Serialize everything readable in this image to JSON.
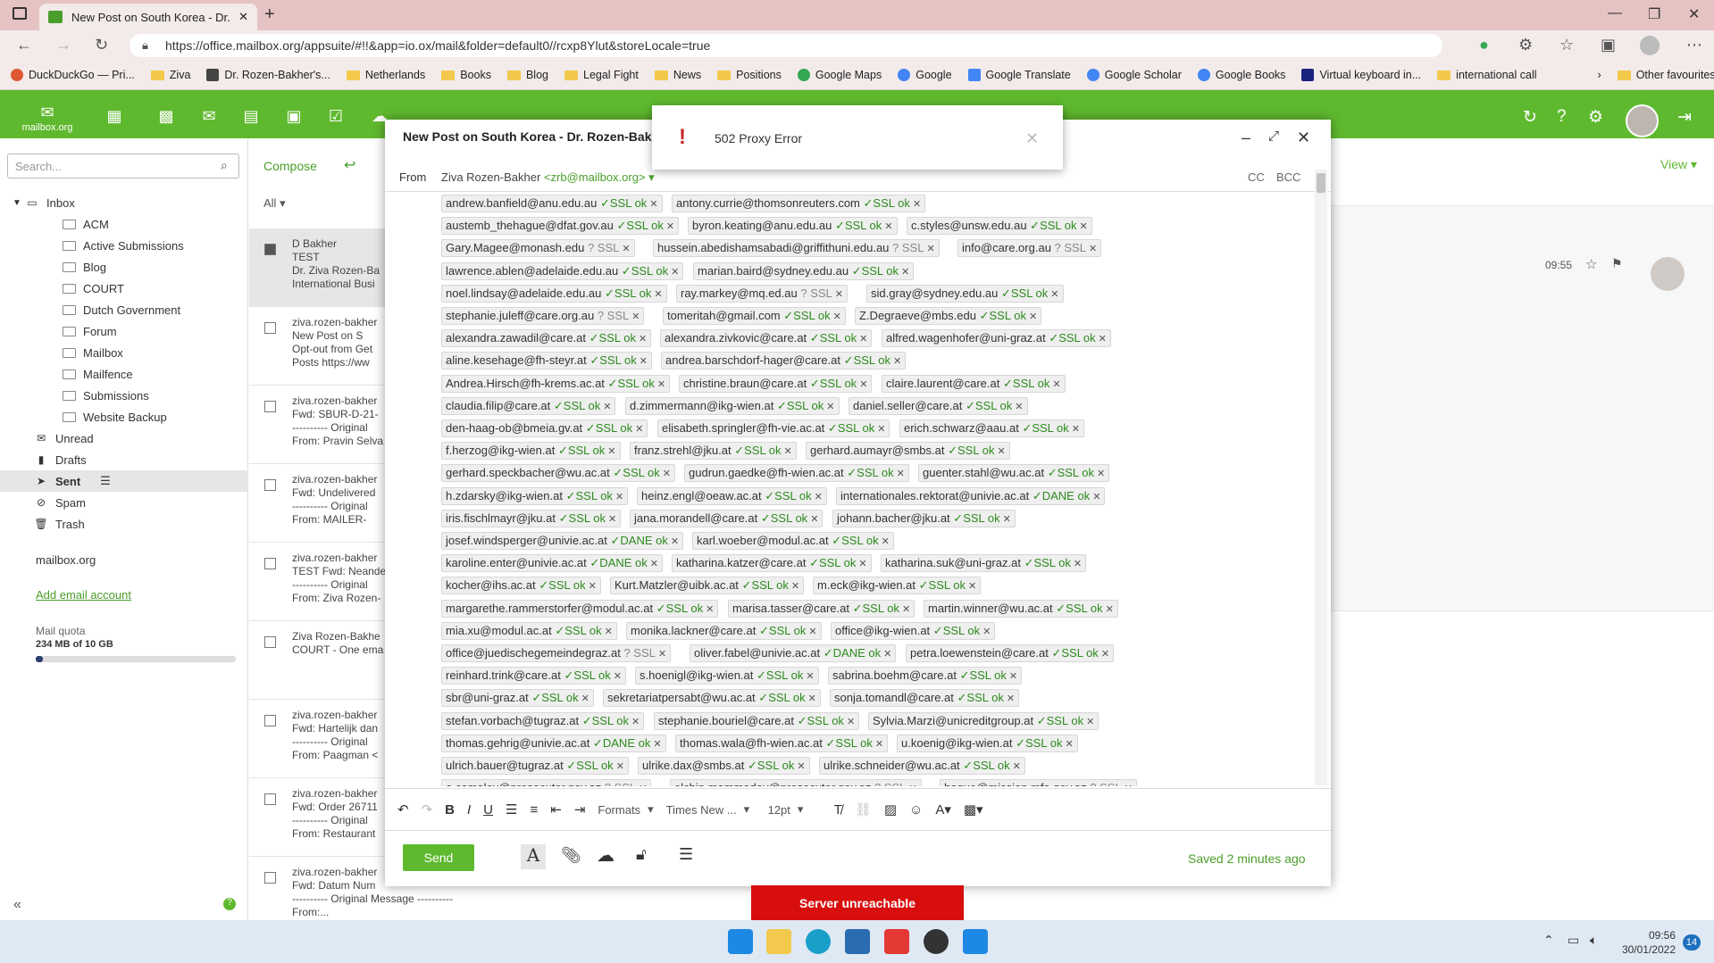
{
  "browser": {
    "tab_title": "New Post on South Korea - Dr. R",
    "url": "https://office.mailbox.org/appsuite/#!!&app=io.ox/mail&folder=default0//rcxp8Ylut&storeLocale=true",
    "bookmarks": [
      "DuckDuckGo — Pri...",
      "Ziva",
      "Dr. Rozen-Bakher's...",
      "Netherlands",
      "Books",
      "Blog",
      "Legal Fight",
      "News",
      "Positions",
      "Google Maps",
      "Google",
      "Google Translate",
      "Google Scholar",
      "Google Books",
      "Virtual keyboard in...",
      "international call"
    ],
    "other_favourites": "Other favourites"
  },
  "app": {
    "logo_text": "mailbox.org",
    "view_label": "View"
  },
  "sidebar": {
    "search_placeholder": "Search...",
    "inbox": "Inbox",
    "inbox_children": [
      "ACM",
      "Active Submissions",
      "Blog",
      "COURT",
      "Dutch Government",
      "Forum",
      "Mailbox",
      "Mailfence",
      "Submissions",
      "Website Backup"
    ],
    "unread": "Unread",
    "drafts": "Drafts",
    "sent": "Sent",
    "spam": "Spam",
    "trash": "Trash",
    "account": "mailbox.org",
    "add_account": "Add email account",
    "quota_label": "Mail quota",
    "quota_value": "234 MB of 10 GB",
    "quota_fraction": 0.023
  },
  "list": {
    "compose": "Compose",
    "filter": "All",
    "rows": [
      {
        "from": "D Bakher",
        "l1": "TEST",
        "l2": "Dr. Ziva Rozen-Ba",
        "l3": "International Busi"
      },
      {
        "from": "ziva.rozen-bakher",
        "l1": "New Post on S",
        "l2": "Opt-out from Get",
        "l3": "Posts  https://ww"
      },
      {
        "from": "ziva.rozen-bakher",
        "l1": "Fwd: SBUR-D-21-",
        "l2": "---------- Original",
        "l3": "From: Pravin Selva"
      },
      {
        "from": "ziva.rozen-bakher",
        "l1": "Fwd: Undelivered",
        "l2": "---------- Original",
        "l3": "From: MAILER-"
      },
      {
        "from": "ziva.rozen-bakher",
        "l1": "TEST Fwd: Neande",
        "l2": "---------- Original",
        "l3": "From: Ziva Rozen-"
      },
      {
        "from": "Ziva Rozen-Bakhe",
        "l1": "COURT - One ema",
        "l2": "",
        "l3": ""
      },
      {
        "from": "ziva.rozen-bakher",
        "l1": "Fwd: Hartelijk dan",
        "l2": "---------- Original",
        "l3": "From: Paagman <"
      },
      {
        "from": "ziva.rozen-bakher",
        "l1": "Fwd: Order 26711",
        "l2": "---------- Original",
        "l3": "From: Restaurant"
      },
      {
        "from": "ziva.rozen-bakher",
        "l1": "Fwd: Datum Num",
        "l2": "---------- Original Message ----------",
        "l3": "From:..."
      }
    ]
  },
  "preview": {
    "time": "09:55"
  },
  "compose": {
    "title": "New Post on South Korea - Dr. Rozen-Bakher's",
    "from_label": "From",
    "from_name": "Ziva Rozen-Bakher",
    "from_email": "<zrb@mailbox.org>",
    "cc": "CC",
    "bcc": "BCC",
    "formats": "Formats",
    "font": "Times New ...",
    "size": "12pt",
    "send": "Send",
    "saved": "Saved 2 minutes ago",
    "recipients": [
      [
        [
          "andrew.banfield@anu.edu.au",
          "SSL ok"
        ],
        [
          "antony.currie@thomsonreuters.com",
          "SSL ok"
        ]
      ],
      [
        [
          "austemb_thehague@dfat.gov.au",
          "SSL ok"
        ],
        [
          "byron.keating@anu.edu.au",
          "SSL ok"
        ],
        [
          "c.styles@unsw.edu.au",
          "SSL ok"
        ]
      ],
      [
        [
          "Gary.Magee@monash.edu",
          "? SSL"
        ],
        [
          "hussein.abedishamsabadi@griffithuni.edu.au",
          "? SSL"
        ],
        [
          "info@care.org.au",
          "? SSL"
        ]
      ],
      [
        [
          "lawrence.ablen@adelaide.edu.au",
          "SSL ok"
        ],
        [
          "marian.baird@sydney.edu.au",
          "SSL ok"
        ]
      ],
      [
        [
          "noel.lindsay@adelaide.edu.au",
          "SSL ok"
        ],
        [
          "ray.markey@mq.ed.au",
          "? SSL"
        ],
        [
          "sid.gray@sydney.edu.au",
          "SSL ok"
        ]
      ],
      [
        [
          "stephanie.juleff@care.org.au",
          "? SSL"
        ],
        [
          "tomeritah@gmail.com",
          "SSL ok"
        ],
        [
          "Z.Degraeve@mbs.edu",
          "SSL ok"
        ]
      ],
      [
        [
          "alexandra.zawadil@care.at",
          "SSL ok"
        ],
        [
          "alexandra.zivkovic@care.at",
          "SSL ok"
        ],
        [
          "alfred.wagenhofer@uni-graz.at",
          "SSL ok"
        ]
      ],
      [
        [
          "aline.kesehage@fh-steyr.at",
          "SSL ok"
        ],
        [
          "andrea.barschdorf-hager@care.at",
          "SSL ok"
        ]
      ],
      [
        [
          "Andrea.Hirsch@fh-krems.ac.at",
          "SSL ok"
        ],
        [
          "christine.braun@care.at",
          "SSL ok"
        ],
        [
          "claire.laurent@care.at",
          "SSL ok"
        ]
      ],
      [
        [
          "claudia.filip@care.at",
          "SSL ok"
        ],
        [
          "d.zimmermann@ikg-wien.at",
          "SSL ok"
        ],
        [
          "daniel.seller@care.at",
          "SSL ok"
        ]
      ],
      [
        [
          "den-haag-ob@bmeia.gv.at",
          "SSL ok"
        ],
        [
          "elisabeth.springler@fh-vie.ac.at",
          "SSL ok"
        ],
        [
          "erich.schwarz@aau.at",
          "SSL ok"
        ]
      ],
      [
        [
          "f.herzog@ikg-wien.at",
          "SSL ok"
        ],
        [
          "franz.strehl@jku.at",
          "SSL ok"
        ],
        [
          "gerhard.aumayr@smbs.at",
          "SSL ok"
        ]
      ],
      [
        [
          "gerhard.speckbacher@wu.ac.at",
          "SSL ok"
        ],
        [
          "gudrun.gaedke@fh-wien.ac.at",
          "SSL ok"
        ],
        [
          "guenter.stahl@wu.ac.at",
          "SSL ok"
        ]
      ],
      [
        [
          "h.zdarsky@ikg-wien.at",
          "SSL ok"
        ],
        [
          "heinz.engl@oeaw.ac.at",
          "SSL ok"
        ],
        [
          "internationales.rektorat@univie.ac.at",
          "DANE ok"
        ]
      ],
      [
        [
          "iris.fischlmayr@jku.at",
          "SSL ok"
        ],
        [
          "jana.morandell@care.at",
          "SSL ok"
        ],
        [
          "johann.bacher@jku.at",
          "SSL ok"
        ]
      ],
      [
        [
          "josef.windsperger@univie.ac.at",
          "DANE ok"
        ],
        [
          "karl.woeber@modul.ac.at",
          "SSL ok"
        ]
      ],
      [
        [
          "karoline.enter@univie.ac.at",
          "DANE ok"
        ],
        [
          "katharina.katzer@care.at",
          "SSL ok"
        ],
        [
          "katharina.suk@uni-graz.at",
          "SSL ok"
        ]
      ],
      [
        [
          "kocher@ihs.ac.at",
          "SSL ok"
        ],
        [
          "Kurt.Matzler@uibk.ac.at",
          "SSL ok"
        ],
        [
          "m.eck@ikg-wien.at",
          "SSL ok"
        ]
      ],
      [
        [
          "margarethe.rammerstorfer@modul.ac.at",
          "SSL ok"
        ],
        [
          "marisa.tasser@care.at",
          "SSL ok"
        ],
        [
          "martin.winner@wu.ac.at",
          "SSL ok"
        ]
      ],
      [
        [
          "mia.xu@modul.ac.at",
          "SSL ok"
        ],
        [
          "monika.lackner@care.at",
          "SSL ok"
        ],
        [
          "office@ikg-wien.at",
          "SSL ok"
        ]
      ],
      [
        [
          "office@juedischegemeindegraz.at",
          "? SSL"
        ],
        [
          "oliver.fabel@univie.ac.at",
          "DANE ok"
        ],
        [
          "petra.loewenstein@care.at",
          "SSL ok"
        ]
      ],
      [
        [
          "reinhard.trink@care.at",
          "SSL ok"
        ],
        [
          "s.hoenigl@ikg-wien.at",
          "SSL ok"
        ],
        [
          "sabrina.boehm@care.at",
          "SSL ok"
        ]
      ],
      [
        [
          "sbr@uni-graz.at",
          "SSL ok"
        ],
        [
          "sekretariatpersabt@wu.ac.at",
          "SSL ok"
        ],
        [
          "sonja.tomandl@care.at",
          "SSL ok"
        ]
      ],
      [
        [
          "stefan.vorbach@tugraz.at",
          "SSL ok"
        ],
        [
          "stephanie.bouriel@care.at",
          "SSL ok"
        ],
        [
          "Sylvia.Marzi@unicreditgroup.at",
          "SSL ok"
        ]
      ],
      [
        [
          "thomas.gehrig@univie.ac.at",
          "DANE ok"
        ],
        [
          "thomas.wala@fh-wien.ac.at",
          "SSL ok"
        ],
        [
          "u.koenig@ikg-wien.at",
          "SSL ok"
        ]
      ],
      [
        [
          "ulrich.bauer@tugraz.at",
          "SSL ok"
        ],
        [
          "ulrike.dax@smbs.at",
          "SSL ok"
        ],
        [
          "ulrike.schneider@wu.ac.at",
          "SSL ok"
        ]
      ],
      [
        [
          "e.camalov@prosecutor.gov.az",
          "? SSL"
        ],
        [
          "elchin.mammadov@prosecutor.gov.az",
          "? SSL"
        ],
        [
          "haque@mission.mfa.gov.az",
          "? SSL"
        ]
      ]
    ]
  },
  "proxy_error": "502 Proxy Error",
  "server_unreachable": "Server unreachable",
  "taskbar": {
    "time": "09:56",
    "date": "30/01/2022",
    "badge": "14"
  },
  "colors": {
    "brand_green": "#5fb92e",
    "error_red": "#d80e0e",
    "ssl_green": "#2d8a1e"
  },
  "icons": [
    "inbox-icon",
    "drafts-icon",
    "sent-icon",
    "spam-icon",
    "trash-icon",
    "refresh-icon",
    "help-icon",
    "settings-icon",
    "logout-icon"
  ]
}
